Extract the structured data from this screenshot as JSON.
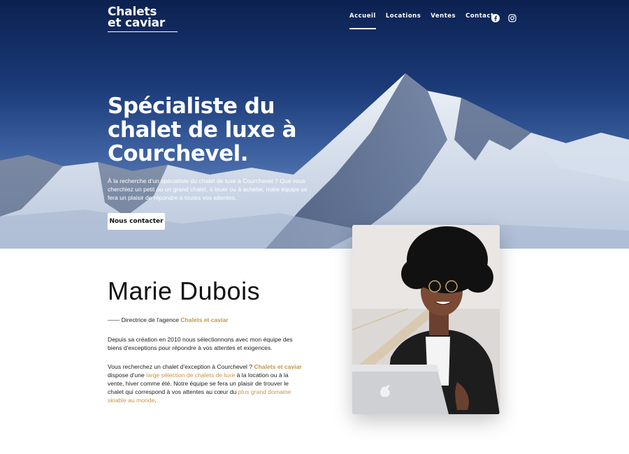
{
  "brand": {
    "logo_line1": "Chalets",
    "logo_line2": "et caviar"
  },
  "nav": {
    "items": [
      "Accueil",
      "Locations",
      "Ventes",
      "Contact"
    ],
    "active": "Accueil"
  },
  "social": {
    "icons": [
      "facebook-icon",
      "instagram-icon"
    ]
  },
  "hero": {
    "title_line1": "Spécialiste du",
    "title_line2": "chalet de luxe à",
    "title_line3": "Courchevel.",
    "text": "À la recherche d'un spécialiste du chalet de luxe à Courchevel ? Que vous cherchiez un petit ou un grand chalet, à louer ou à acheter, notre équipe se fera un plaisir de répondre à toutes vos attentes.",
    "cta_label": "Nous contacter"
  },
  "profile": {
    "name": "Marie Dubois",
    "role_prefix": "—— Directrice de l'agence ",
    "role_agency": "Chalets et caviar",
    "para1": "Depuis sa création en 2010 nous sélectionnons avec mon équipe des biens d'exceptions pour répondre à vos attentes et exigences.",
    "para2_part1": "Vous recherchez un chalet d'exception à Courchevel ? ",
    "para2_brand": "Chalets et caviar",
    "para2_part2": " dispose d'une ",
    "para2_link1": "large sélection de chalets de luxe",
    "para2_part3": " à la location ou à la vente, hiver comme été. Notre équipe se fera un plaisir de trouver le chalet qui correspond à vos attentes au cœur du ",
    "para2_link2": "plus grand domaine skiable au monde",
    "para2_part4": "."
  },
  "colors": {
    "accent": "#c9944a",
    "hero_sky": "#0c2150",
    "text": "#222222"
  }
}
